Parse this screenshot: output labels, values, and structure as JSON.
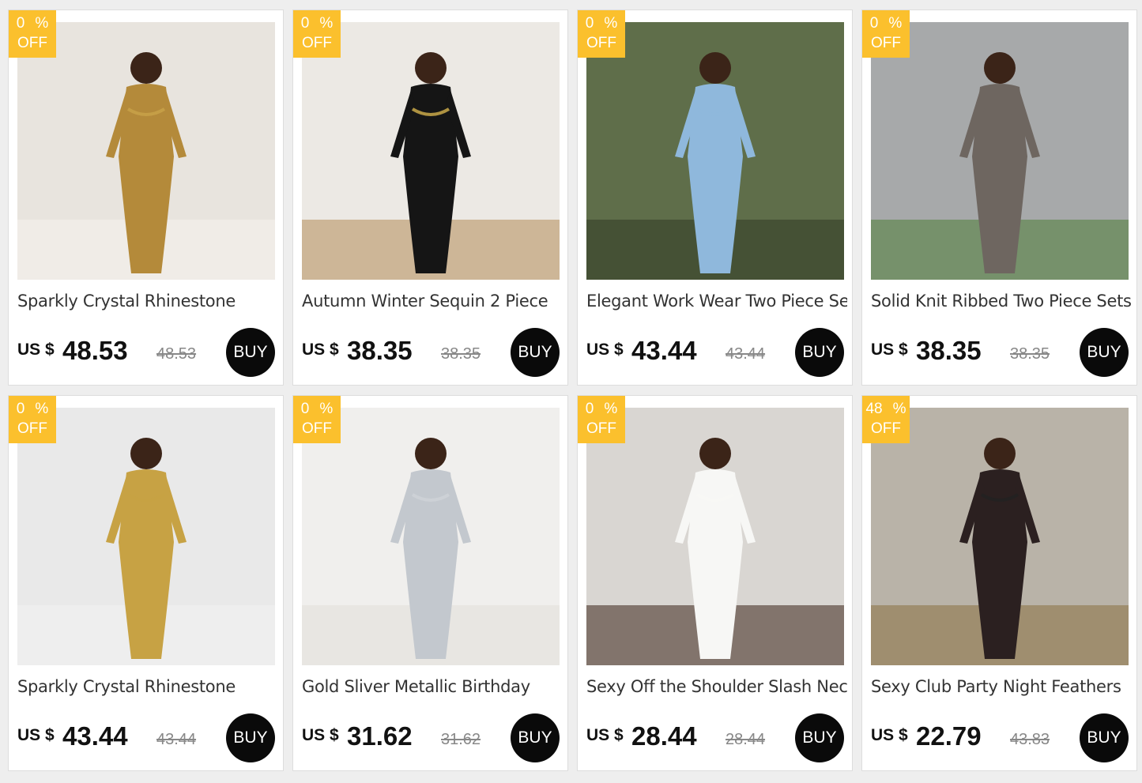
{
  "currency_label": "US $",
  "badge_off_label": "OFF",
  "buy_label": "BUY",
  "colors": {
    "badge": "#fbc02d",
    "buy_button": "#0a0a0a"
  },
  "products": [
    {
      "title": "Sparkly Crystal Rhinestone",
      "price": "48.53",
      "old_price": "48.53",
      "discount": "0",
      "pct": "%",
      "image": {
        "bg": "#e8e4de",
        "accent": "#c9a24a",
        "figure": "#b48a3a",
        "extra": "#f5f3ef"
      }
    },
    {
      "title": "Autumn Winter Sequin 2 Piece",
      "price": "38.35",
      "old_price": "38.35",
      "discount": "0",
      "pct": "%",
      "image": {
        "bg": "#ece9e4",
        "accent": "#d4b24c",
        "figure": "#151515",
        "extra": "#b58d58"
      }
    },
    {
      "title": "Elegant Work Wear Two Piece Set",
      "price": "43.44",
      "old_price": "43.44",
      "discount": "0",
      "pct": "%",
      "image": {
        "bg": "#5f6e4a",
        "accent": "#8fb8dc",
        "figure": "#8fb8dc",
        "extra": "#2f3b25"
      }
    },
    {
      "title": "Solid Knit Ribbed Two Piece Sets",
      "price": "38.35",
      "old_price": "38.35",
      "discount": "0",
      "pct": "%",
      "image": {
        "bg": "#a7a9aa",
        "accent": "#6e6660",
        "figure": "#6e6660",
        "extra": "#4f7d36"
      }
    },
    {
      "title": "Sparkly Crystal Rhinestone",
      "price": "43.44",
      "old_price": "43.44",
      "discount": "0",
      "pct": "%",
      "image": {
        "bg": "#e9e9e9",
        "accent": "#c7a244",
        "figure": "#c7a244",
        "extra": "#f2f2f2"
      }
    },
    {
      "title": "Gold Sliver Metallic Birthday",
      "price": "31.62",
      "old_price": "31.62",
      "discount": "0",
      "pct": "%",
      "image": {
        "bg": "#f0efed",
        "accent": "#cfd3d8",
        "figure": "#c3c8ce",
        "extra": "#e2dfd9"
      }
    },
    {
      "title": "Sexy Off the Shoulder Slash Neck",
      "price": "28.44",
      "old_price": "28.44",
      "discount": "0",
      "pct": "%",
      "image": {
        "bg": "#d9d6d2",
        "accent": "#f7f7f5",
        "figure": "#f7f7f5",
        "extra": "#3a2418"
      }
    },
    {
      "title": "Sexy Club Party Night Feathers",
      "price": "22.79",
      "old_price": "43.83",
      "discount": "48",
      "pct": "%",
      "image": {
        "bg": "#b9b3a8",
        "accent": "#222222",
        "figure": "#2b2020",
        "extra": "#8a7040"
      }
    }
  ]
}
